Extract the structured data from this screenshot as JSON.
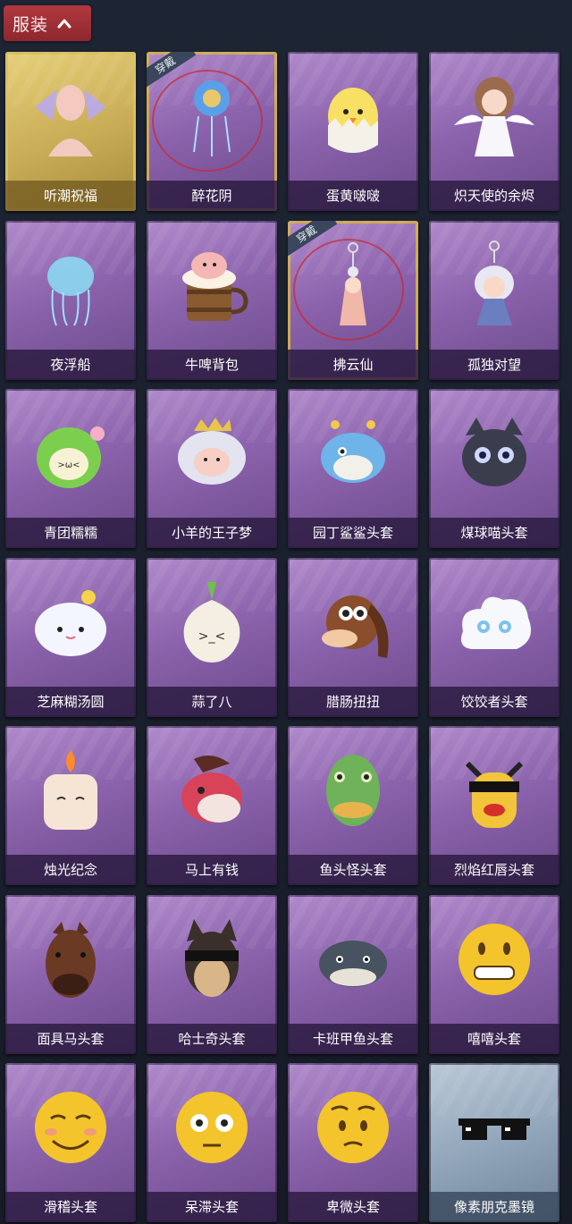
{
  "header": {
    "title": "服装",
    "toggle_icon": "chevron-up-icon",
    "color": "#a3323a"
  },
  "equipped_tag_text": "穿戴",
  "items": [
    {
      "label": "听潮祝福",
      "icon": "mannequin-wings-icon",
      "rarity": "gold",
      "equipped": false
    },
    {
      "label": "醉花阴",
      "icon": "flower-ornament-icon",
      "rarity": "purple",
      "equipped": true
    },
    {
      "label": "蛋黄啵啵",
      "icon": "chick-egg-icon",
      "rarity": "purple",
      "equipped": false
    },
    {
      "label": "炽天使的余烬",
      "icon": "angel-doll-icon",
      "rarity": "purple",
      "equipped": false
    },
    {
      "label": "夜浮船",
      "icon": "jellyfish-icon",
      "rarity": "purple",
      "equipped": false
    },
    {
      "label": "牛啤背包",
      "icon": "beer-mug-cow-icon",
      "rarity": "purple",
      "equipped": false
    },
    {
      "label": "拂云仙",
      "icon": "charm-pendant-icon",
      "rarity": "purple",
      "equipped": true
    },
    {
      "label": "孤独对望",
      "icon": "doll-pendant-icon",
      "rarity": "purple",
      "equipped": false
    },
    {
      "label": "青团糯糯",
      "icon": "green-mochi-icon",
      "rarity": "purple",
      "equipped": false
    },
    {
      "label": "小羊的王子梦",
      "icon": "sheep-crown-icon",
      "rarity": "purple",
      "equipped": false
    },
    {
      "label": "园丁鲨鲨头套",
      "icon": "shark-bee-icon",
      "rarity": "purple",
      "equipped": false
    },
    {
      "label": "煤球喵头套",
      "icon": "black-cat-icon",
      "rarity": "purple",
      "equipped": false
    },
    {
      "label": "芝麻糊汤圆",
      "icon": "rice-ball-icon",
      "rarity": "purple",
      "equipped": false
    },
    {
      "label": "蒜了八",
      "icon": "garlic-icon",
      "rarity": "purple",
      "equipped": false
    },
    {
      "label": "腊肠扭扭",
      "icon": "dachshund-icon",
      "rarity": "purple",
      "equipped": false
    },
    {
      "label": "饺饺者头套",
      "icon": "cloud-dumpling-icon",
      "rarity": "purple",
      "equipped": false
    },
    {
      "label": "烛光纪念",
      "icon": "candle-icon",
      "rarity": "purple",
      "equipped": false
    },
    {
      "label": "马上有钱",
      "icon": "red-horse-icon",
      "rarity": "purple",
      "equipped": false
    },
    {
      "label": "鱼头怪头套",
      "icon": "fish-mask-icon",
      "rarity": "purple",
      "equipped": false
    },
    {
      "label": "烈焰红唇头套",
      "icon": "yellow-mask-icon",
      "rarity": "purple",
      "equipped": false
    },
    {
      "label": "面具马头套",
      "icon": "horse-mask-icon",
      "rarity": "purple",
      "equipped": false
    },
    {
      "label": "哈士奇头套",
      "icon": "husky-icon",
      "rarity": "purple",
      "equipped": false
    },
    {
      "label": "卡班甲鱼头套",
      "icon": "turtle-head-icon",
      "rarity": "purple",
      "equipped": false
    },
    {
      "label": "嘻嘻头套",
      "icon": "grin-emoji-icon",
      "rarity": "purple",
      "equipped": false
    },
    {
      "label": "滑稽头套",
      "icon": "funny-emoji-icon",
      "rarity": "purple",
      "equipped": false
    },
    {
      "label": "呆滞头套",
      "icon": "stare-emoji-icon",
      "rarity": "purple",
      "equipped": false
    },
    {
      "label": "卑微头套",
      "icon": "humble-emoji-icon",
      "rarity": "purple",
      "equipped": false
    },
    {
      "label": "像素朋克墨镜",
      "icon": "pixel-sunglasses-icon",
      "rarity": "blue",
      "equipped": false
    }
  ]
}
